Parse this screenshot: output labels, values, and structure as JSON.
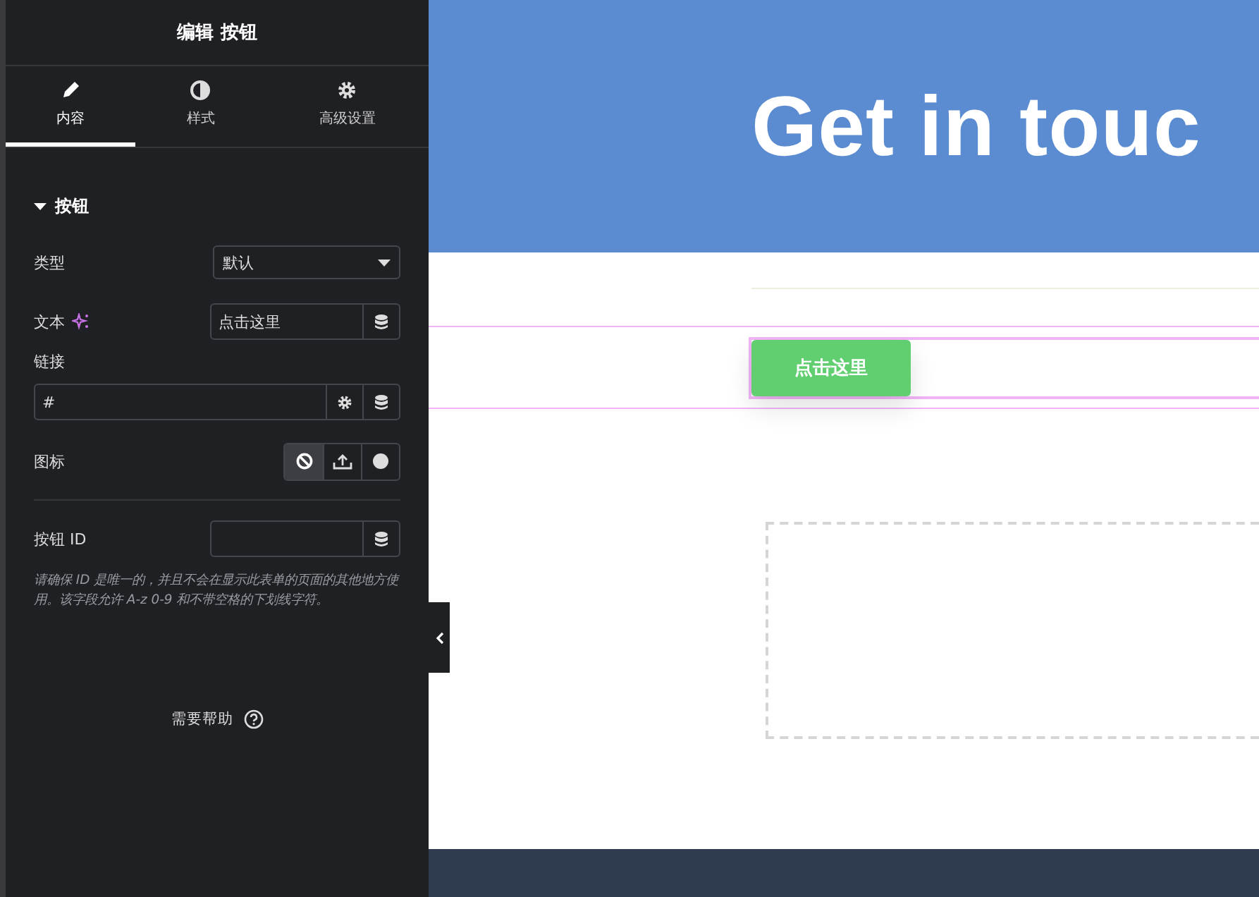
{
  "panel": {
    "title": "编辑 按钮",
    "tabs": [
      {
        "label": "内容",
        "selected": true
      },
      {
        "label": "样式",
        "selected": false
      },
      {
        "label": "高级设置",
        "selected": false
      }
    ],
    "section": {
      "title": "按钮",
      "expanded": true
    },
    "controls": [
      {
        "kind": "select",
        "label": "类型",
        "value": "默认"
      },
      {
        "kind": "text",
        "label": "文本",
        "ai": true,
        "value": "点击这里"
      },
      {
        "kind": "url",
        "label": "链接",
        "value": "#"
      },
      {
        "kind": "choice",
        "label": "图标",
        "options": [
          {
            "selected": true
          },
          {
            "selected": false
          },
          {
            "selected": false
          }
        ]
      },
      {
        "kind": "divider"
      },
      {
        "kind": "text",
        "label": "按钮 ID",
        "ai": false
      },
      {
        "kind": "note",
        "text": "请确保 ID 是唯一的，并且不会在显示此表单的页面的其他地方使用。该字段允许 A-z 0-9 和不带空格的下划线字符。"
      }
    ],
    "help": "需要帮助"
  },
  "preview": {
    "heading": "Get in touc",
    "button": "点击这里"
  }
}
